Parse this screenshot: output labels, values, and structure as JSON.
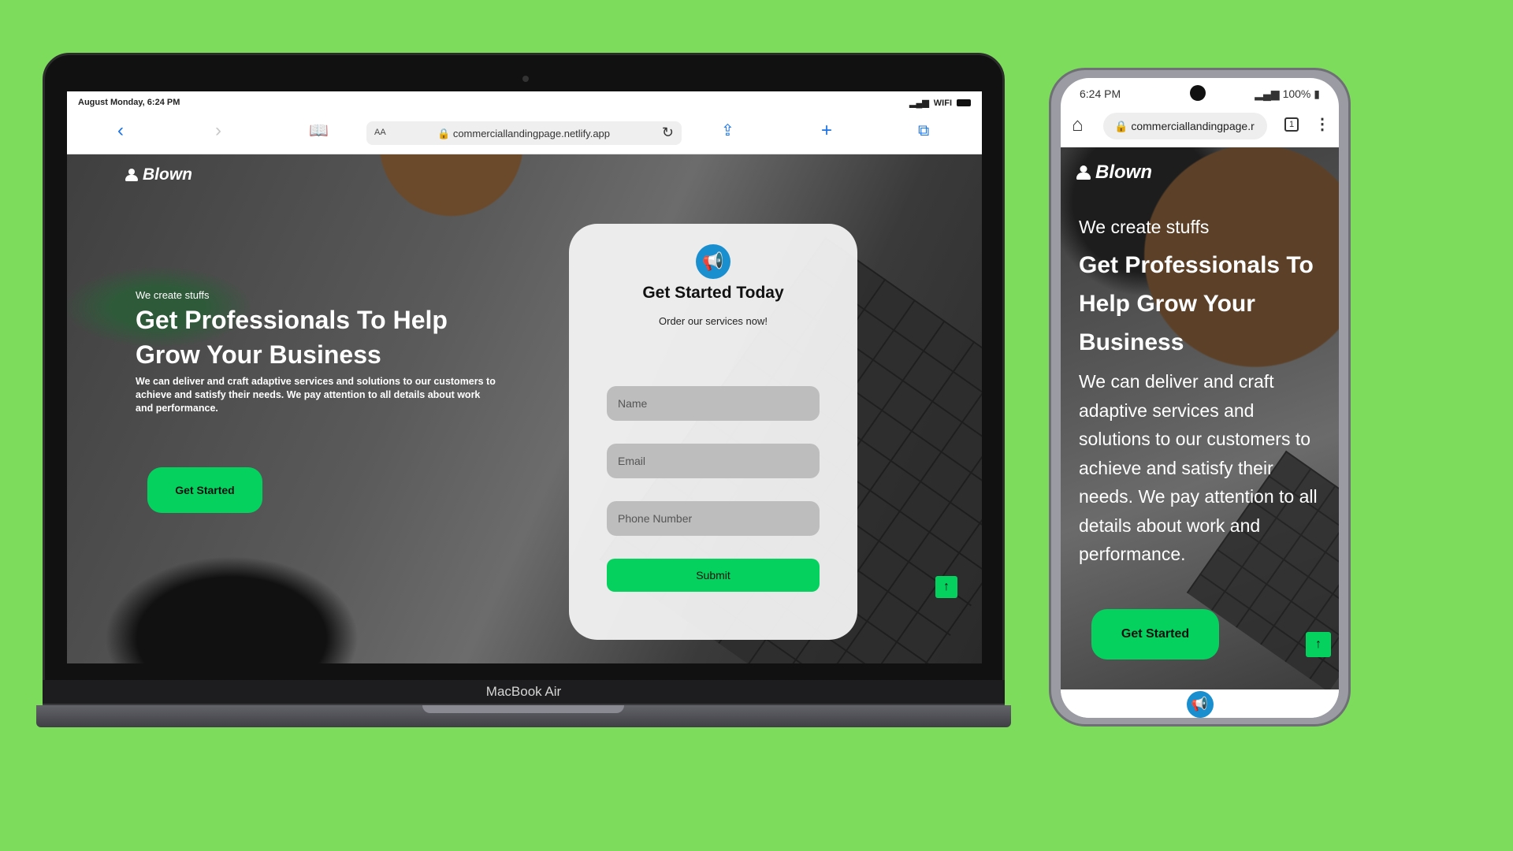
{
  "laptop": {
    "model_label": "MacBook Air",
    "status_bar": {
      "time": "August Monday, 6:24 PM",
      "signal": "WIFI"
    },
    "browser": {
      "back_icon": "chevron-left-icon",
      "forward_icon": "chevron-right-icon",
      "text_size_label": "AA",
      "url": "commerciallandingpage.netlify.app",
      "accent": "#1a73e8"
    }
  },
  "site": {
    "brand": "Blown",
    "eyebrow": "We create stuffs",
    "headline": "Get Professionals To Help Grow Your Business",
    "description": "We can deliver and craft adaptive services and solutions to our customers to achieve and satisfy their needs. We pay attention to all details about work and performance.",
    "cta_label": "Get Started",
    "scroll_top_glyph": "↑",
    "accent": "#05d15f",
    "form": {
      "icon": "megaphone-icon",
      "title": "Get Started Today",
      "subtitle": "Order our services now!",
      "name_placeholder": "Name",
      "email_placeholder": "Email",
      "phone_placeholder": "Phone Number",
      "submit_label": "Submit"
    }
  },
  "phone": {
    "status_bar": {
      "time": "6:24 PM",
      "battery": "100%"
    },
    "browser": {
      "url": "commerciallandingpage.r",
      "tab_count": "1"
    }
  },
  "background_color": "#7ddc5c"
}
